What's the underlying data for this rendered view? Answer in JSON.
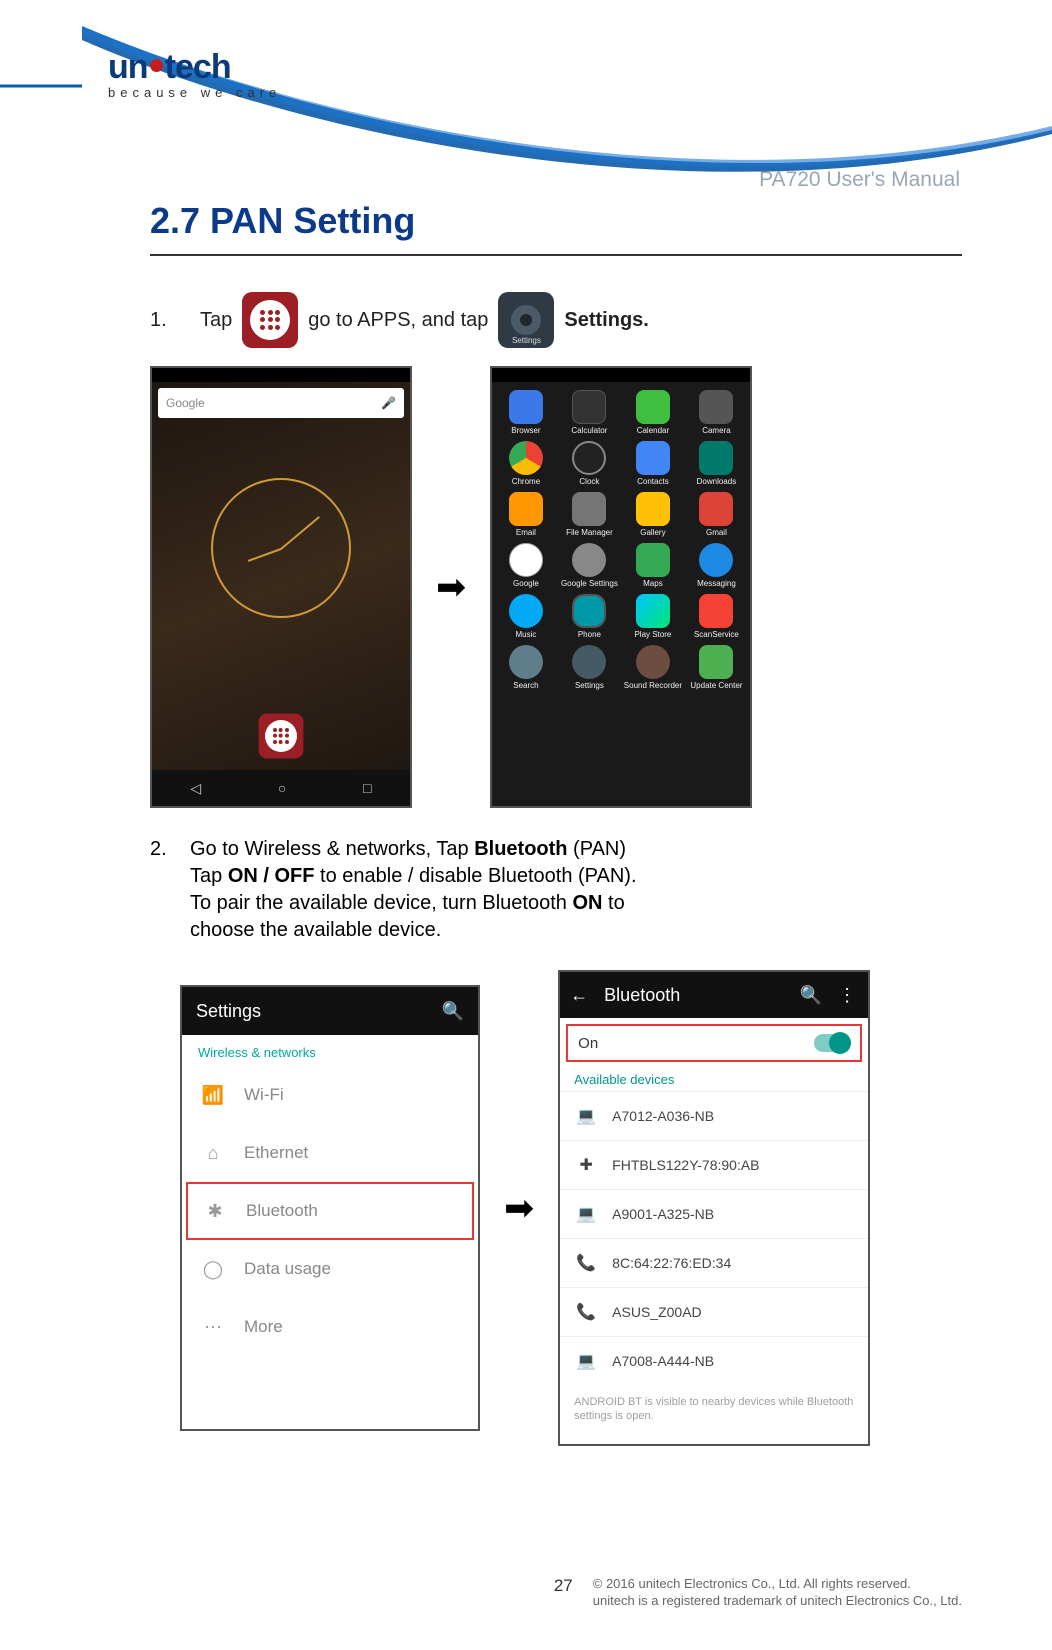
{
  "logo": {
    "name_pre": "un",
    "name_post": "tech",
    "tagline": "because we care"
  },
  "doc_title": "PA720 User's Manual",
  "section_heading": "2.7 PAN Setting",
  "step1": {
    "num": "1.",
    "t1": "Tap",
    "t2": "go to APPS, and tap",
    "t3": "Settings.",
    "settings_icon_label": "Settings"
  },
  "home_screen": {
    "search_placeholder": "Google",
    "nav": {
      "back": "◁",
      "home": "○",
      "recent": "□"
    }
  },
  "apps_grid": [
    {
      "label": "Browser",
      "ic": "browser"
    },
    {
      "label": "Calculator",
      "ic": "calc"
    },
    {
      "label": "Calendar",
      "ic": "cal"
    },
    {
      "label": "Camera",
      "ic": "cam"
    },
    {
      "label": "Chrome",
      "ic": "chrome"
    },
    {
      "label": "Clock",
      "ic": "clock"
    },
    {
      "label": "Contacts",
      "ic": "contacts"
    },
    {
      "label": "Downloads",
      "ic": "dl"
    },
    {
      "label": "Email",
      "ic": "email"
    },
    {
      "label": "File Manager",
      "ic": "fm"
    },
    {
      "label": "Gallery",
      "ic": "gal"
    },
    {
      "label": "Gmail",
      "ic": "gmail"
    },
    {
      "label": "Google",
      "ic": "goog"
    },
    {
      "label": "Google Settings",
      "ic": "gset"
    },
    {
      "label": "Maps",
      "ic": "maps"
    },
    {
      "label": "Messaging",
      "ic": "msg"
    },
    {
      "label": "Music",
      "ic": "music"
    },
    {
      "label": "Phone",
      "ic": "phone"
    },
    {
      "label": "Play Store",
      "ic": "play"
    },
    {
      "label": "ScanService",
      "ic": "scan"
    },
    {
      "label": "Search",
      "ic": "srch"
    },
    {
      "label": "Settings",
      "ic": "set"
    },
    {
      "label": "Sound Recorder",
      "ic": "snd"
    },
    {
      "label": "Update Center",
      "ic": "upd"
    }
  ],
  "step2": {
    "num": "2.",
    "l1a": "Go to Wireless & networks, Tap ",
    "l1b": "Bluetooth",
    "l1c": " (PAN)",
    "l2a": "Tap ",
    "l2b": "ON / OFF",
    "l2c": " to enable / disable Bluetooth (PAN).",
    "l3a": "To pair the available device, turn Bluetooth ",
    "l3b": "ON",
    "l3c": " to",
    "l4": "choose the available device."
  },
  "settings_screen": {
    "title": "Settings",
    "search_icon": "search",
    "section": "Wireless & networks",
    "items": [
      {
        "label": "Wi-Fi",
        "icon": "▾",
        "hl": false
      },
      {
        "label": "Ethernet",
        "icon": "⌂",
        "hl": false
      },
      {
        "label": "Bluetooth",
        "icon": "✱",
        "hl": true
      },
      {
        "label": "Data usage",
        "icon": "○",
        "hl": false
      },
      {
        "label": "More",
        "icon": "⋯",
        "hl": false
      }
    ]
  },
  "bluetooth_screen": {
    "back": "←",
    "title": "Bluetooth",
    "search": "search",
    "menu": "⋮",
    "on_label": "On",
    "section": "Available devices",
    "devices": [
      {
        "icon": "💻",
        "name": "A7012-A036-NB"
      },
      {
        "icon": "✚",
        "name": "FHTBLS122Y-78:90:AB"
      },
      {
        "icon": "💻",
        "name": "A9001-A325-NB"
      },
      {
        "icon": "📞",
        "name": "8C:64:22:76:ED:34"
      },
      {
        "icon": "📞",
        "name": "ASUS_Z00AD"
      },
      {
        "icon": "💻",
        "name": "A7008-A444-NB"
      }
    ],
    "note": "ANDROID BT is visible to nearby devices while Bluetooth settings is open."
  },
  "footer": {
    "page": "27",
    "copyright1": "© 2016 unitech Electronics Co., Ltd. All rights reserved.",
    "copyright2": "unitech is a registered trademark of unitech Electronics Co., Ltd."
  }
}
